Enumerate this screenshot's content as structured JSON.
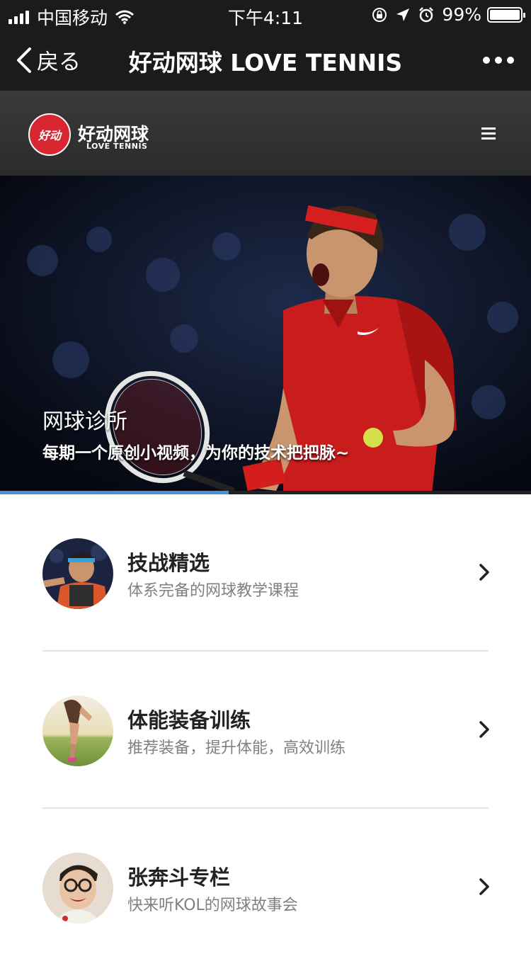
{
  "status_bar": {
    "carrier": "中国移动",
    "time": "下午4:11",
    "battery": "99%",
    "battery_level": 0.99
  },
  "nav": {
    "back_label": "戻る",
    "title": "好动网球 LOVE TENNIS"
  },
  "site_header": {
    "logo_mark": "好动",
    "logo_name": "好动网球",
    "logo_sub": "LOVE TENNIS",
    "menu_icon": "hamburger-icon"
  },
  "banner": {
    "title": "网球诊所",
    "subtitle": "每期一个原创小视频，为你的技术把把脉~",
    "progress": 0.43
  },
  "items": [
    {
      "title": "技战精选",
      "subtitle": "体系完备的网球教学课程",
      "avatar": "player-avatar"
    },
    {
      "title": "体能装备训练",
      "subtitle": "推荐装备，提升体能，高效训练",
      "avatar": "runner-avatar"
    },
    {
      "title": "张奔斗专栏",
      "subtitle": "快来听KOL的网球故事会",
      "avatar": "caricature-avatar"
    }
  ],
  "colors": {
    "bar": "#1b1b1d",
    "brand_red": "#d7262f",
    "progress": "#4a90d9"
  }
}
